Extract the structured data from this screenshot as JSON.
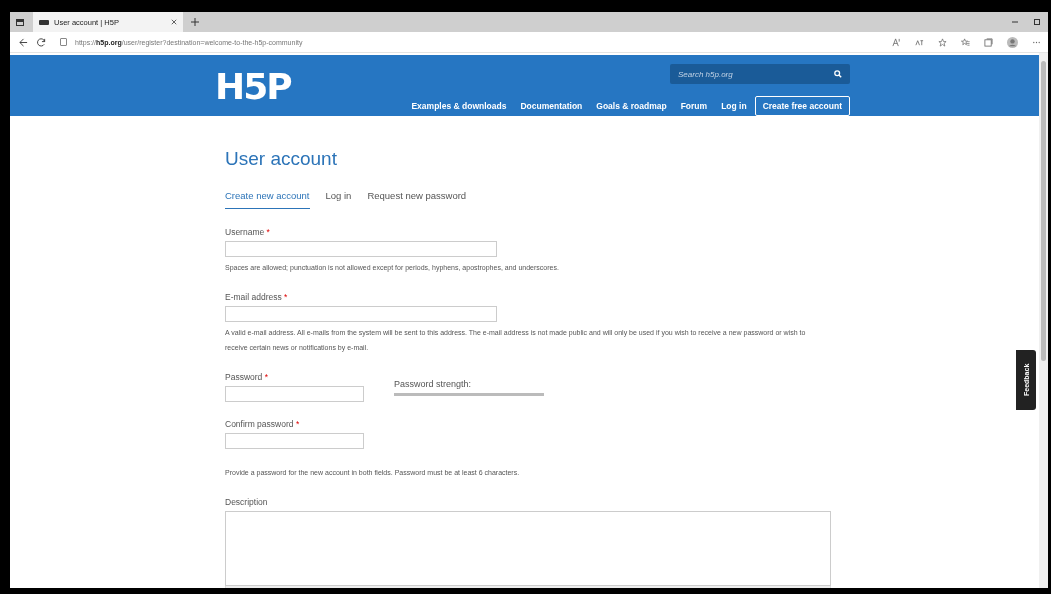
{
  "browser": {
    "tab_title": "User account | H5P",
    "url": "https://**h5p.org**/user/register?destination=welcome-to-the-h5p-community"
  },
  "header": {
    "logo": "H5P",
    "search": {
      "placeholder": "Search h5p.org"
    },
    "nav": [
      {
        "label": "Examples & downloads",
        "kind": "link"
      },
      {
        "label": "Documentation",
        "kind": "link"
      },
      {
        "label": "Goals & roadmap",
        "kind": "link"
      },
      {
        "label": "Forum",
        "kind": "link"
      },
      {
        "label": "Log in",
        "kind": "link"
      },
      {
        "label": "Create free account",
        "kind": "button"
      }
    ]
  },
  "page_title": "User account",
  "required_mark": "*",
  "tabs": [
    {
      "label": "Create new account",
      "selected": true
    },
    {
      "label": "Log in",
      "selected": false
    },
    {
      "label": "Request new password",
      "selected": false
    }
  ],
  "fields": [
    {
      "label": "Username",
      "required": true,
      "kind": "text",
      "help": "Spaces are allowed; punctuation is not allowed except for periods, hyphens, apostrophes, and underscores."
    },
    {
      "label": "E-mail address",
      "required": true,
      "kind": "text",
      "help": "A valid e-mail address. All e-mails from the system will be sent to this address. The e-mail address is not made public and will only be used if you wish to receive a new password or wish to receive certain news or notifications by e-mail."
    },
    {
      "label": "Password",
      "required": true,
      "kind": "password",
      "strength_label": "Password strength:"
    },
    {
      "label": "Confirm password",
      "required": true,
      "kind": "short",
      "help": "Provide a password for the new account in both fields. Password must be at least 6 characters."
    },
    {
      "label": "Description",
      "required": false,
      "kind": "textarea"
    }
  ],
  "feedback_tab": "Feedback"
}
